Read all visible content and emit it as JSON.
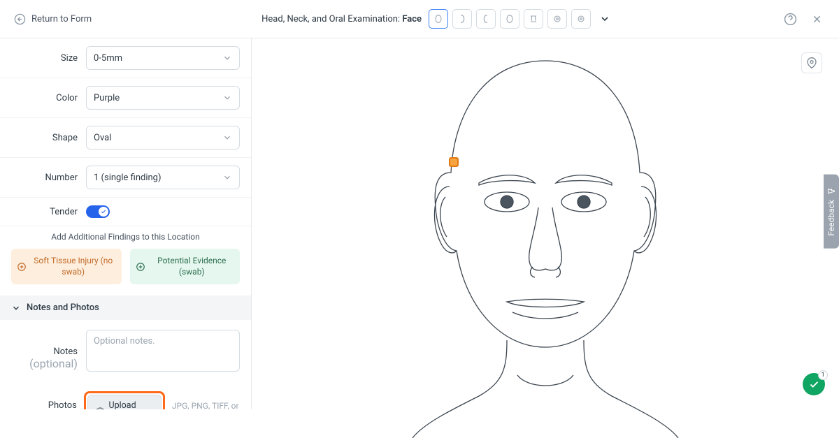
{
  "header": {
    "return_label": "Return to Form",
    "exam_prefix": "Head, Neck, and Oral Examination: ",
    "exam_current": "Face"
  },
  "form": {
    "size": {
      "label": "Size",
      "value": "0-5mm"
    },
    "color": {
      "label": "Color",
      "value": "Purple"
    },
    "shape": {
      "label": "Shape",
      "value": "Oval"
    },
    "number": {
      "label": "Number",
      "value": "1 (single finding)"
    },
    "tender": {
      "label": "Tender",
      "on": true
    },
    "add_label": "Add Additional Findings to this Location",
    "chip_soft": "Soft Tissue Injury (no swab)",
    "chip_evidence": "Potential Evidence (swab)"
  },
  "notes_section": {
    "header": "Notes and Photos",
    "notes_label": "Notes",
    "optional": " (optional)",
    "placeholder": "Optional notes.",
    "photos_label": "Photos",
    "upload_label": "Upload Photos",
    "file_hint": "JPG, PNG, TIFF, or HIEC"
  },
  "feedback_label": "Feedback",
  "fab_badge": "1"
}
